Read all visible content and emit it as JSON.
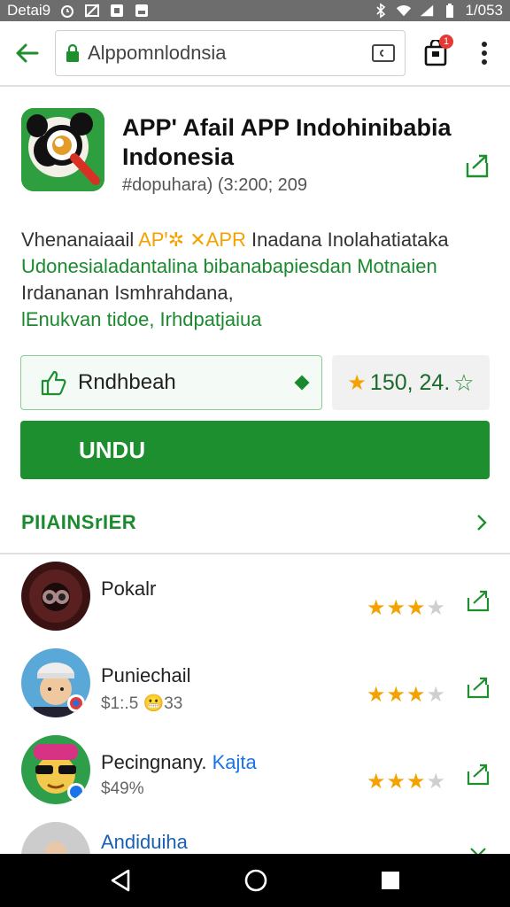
{
  "status_bar": {
    "left_text": "Detai9",
    "time": "1/053",
    "icons": [
      "alarm-icon",
      "no-image-icon",
      "notification-icon",
      "photo-icon",
      "bluetooth-icon",
      "wifi-icon",
      "signal-icon",
      "battery-icon"
    ]
  },
  "browser": {
    "url": "Alppomnlodnsia",
    "badge_count": "1"
  },
  "app": {
    "title": "APP' Afail APP Indohinibabia Indonesia",
    "meta": "#dopuhara) (3:200; 209"
  },
  "description": {
    "line1_a": "Vhenanaiaail ",
    "line1_highlight": "APꞌ✲ ✕APR",
    "line1_b": " Inadana Inolahatiataka",
    "line2": "Udonesialadantalina bibanabapiesdan Motnaien",
    "line3": "Irdananan Ismhrahdana,",
    "line4": "lEnukvan tidoe, Irhdpatjaiua"
  },
  "install_select": {
    "label": "Rndhbeah"
  },
  "rating": {
    "value": "150, 24."
  },
  "download_button": {
    "label": "UNDU"
  },
  "section": {
    "title": "PIIAINSrIER"
  },
  "reviews": [
    {
      "name": "Pokalr",
      "sub": "",
      "stars": 3
    },
    {
      "name": "Puniechail",
      "sub": "$1:.5 😬33",
      "stars": 3
    },
    {
      "name_a": "Pecingnany. ",
      "name_b": "Kajta",
      "sub": "$49%",
      "stars": 3
    },
    {
      "name": "Andiduiha",
      "sub": "",
      "stars": 0
    }
  ],
  "colors": {
    "accent_green": "#1e8f2f",
    "star": "#f4a200",
    "status_bar": "#6d6d6d"
  }
}
